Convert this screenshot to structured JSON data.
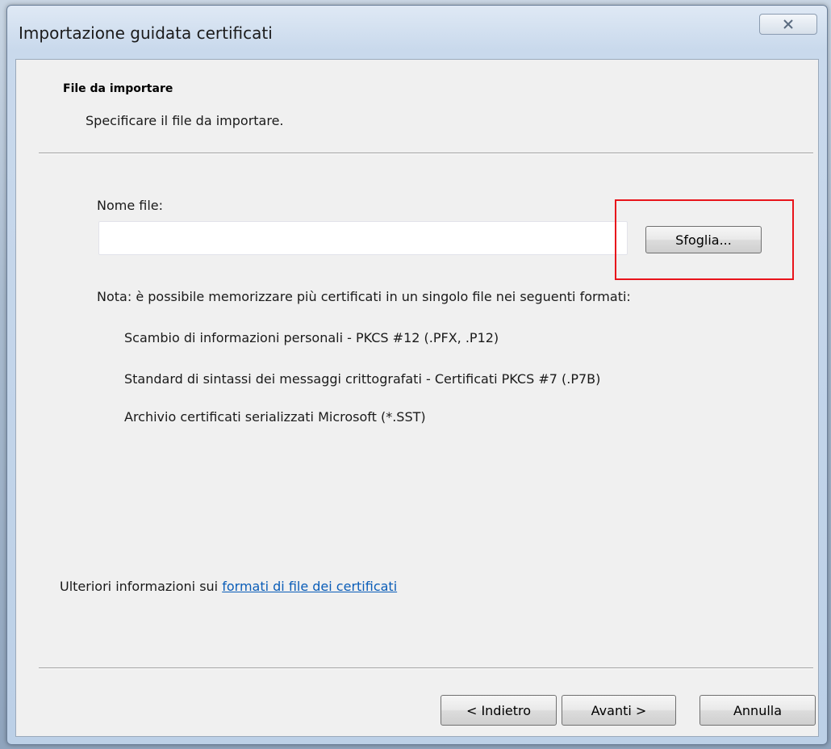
{
  "window": {
    "title": "Importazione guidata certificati"
  },
  "header": {
    "section_title": "File da importare",
    "section_subtitle": "Specificare il file da importare."
  },
  "file": {
    "label": "Nome file:",
    "value": "",
    "placeholder": "",
    "browse_label": "Sfoglia..."
  },
  "note": {
    "text": "Nota: è possibile memorizzare più certificati in un singolo file nei seguenti formati:",
    "formats": [
      "Scambio di informazioni personali - PKCS #12 (.PFX, .P12)",
      "Standard di sintassi dei messaggi crittografati - Certificati PKCS #7 (.P7B)",
      "Archivio certificati serializzati Microsoft (*.SST)"
    ]
  },
  "more_info": {
    "prefix": "Ulteriori informazioni sui",
    "link": "formati di file dei certificati"
  },
  "buttons": {
    "back": "< Indietro",
    "next": "Avanti >",
    "cancel": "Annulla"
  },
  "icons": {
    "close": "close-icon"
  },
  "colors": {
    "highlight": "#e8141b",
    "link": "#0a5db8"
  }
}
